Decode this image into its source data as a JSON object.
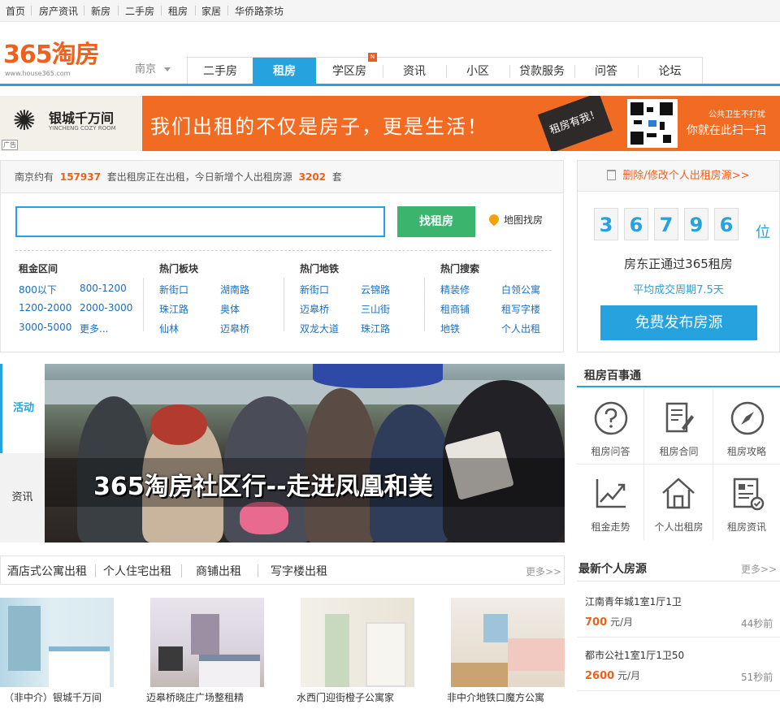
{
  "topbar": {
    "items": [
      "首页",
      "房产资讯",
      "新房",
      "二手房",
      "租房",
      "家居",
      "华侨路茶坊"
    ]
  },
  "logo": {
    "text": "365淘房",
    "url": "www.house365.com"
  },
  "city": "南京",
  "nav": {
    "tabs": [
      "二手房",
      "租房",
      "学区房",
      "资讯",
      "小区",
      "贷款服务",
      "问答",
      "论坛"
    ],
    "active": 1,
    "badge": "N"
  },
  "banner": {
    "ad_label": "广告",
    "brand_name": "银城千万间",
    "brand_sub": "YINCHENG COZY ROOM",
    "slogan": "我们出租的不仅是房子，更是生活！",
    "stamp": "租房有我！",
    "qr_text1": "公共卫生不打扰",
    "qr_text2": "你就在此扫一扫"
  },
  "search": {
    "stat_prefix": "南京约有",
    "stat_total": "157937",
    "stat_mid": "套出租房正在出租，今日新增个人出租房源",
    "stat_new": "3202",
    "stat_suffix": "套",
    "placeholder": "",
    "button": "找租房",
    "map_link": "地图找房",
    "columns": [
      {
        "title": "租金区间",
        "links": [
          "800以下",
          "800-1200",
          "1200-2000",
          "2000-3000",
          "3000-5000",
          "更多..."
        ]
      },
      {
        "title": "热门板块",
        "links": [
          "新街口",
          "湖南路",
          "珠江路",
          "奥体",
          "仙林",
          "迈皋桥"
        ]
      },
      {
        "title": "热门地铁",
        "links": [
          "新街口",
          "云锦路",
          "迈皋桥",
          "三山街",
          "双龙大道",
          "珠江路"
        ]
      },
      {
        "title": "热门搜索",
        "links": [
          "精装修",
          "白领公寓",
          "租商铺",
          "租写字楼",
          "地铁",
          "个人出租"
        ]
      }
    ]
  },
  "publish": {
    "delete_link": "删除/修改个人出租房源>>",
    "digits": [
      "3",
      "6",
      "7",
      "9",
      "6"
    ],
    "unit": "位",
    "line1": "房东正通过365租房",
    "line2": "平均成交周期7.5天",
    "button": "免费发布房源"
  },
  "slider": {
    "tabs": [
      "活动",
      "资讯"
    ],
    "caption": "365淘房社区行--走进凤凰和美"
  },
  "services": {
    "title": "租房百事通",
    "items": [
      {
        "label": "租房问答",
        "icon": "question-icon"
      },
      {
        "label": "租房合同",
        "icon": "contract-icon"
      },
      {
        "label": "租房攻略",
        "icon": "compass-icon"
      },
      {
        "label": "租金走势",
        "icon": "trend-chart-icon"
      },
      {
        "label": "个人出租房",
        "icon": "house-icon"
      },
      {
        "label": "租房资讯",
        "icon": "news-icon"
      }
    ]
  },
  "listing": {
    "tabs": [
      "酒店式公寓出租",
      "个人住宅出租",
      "商铺出租",
      "写字楼出租"
    ],
    "more": "更多>>",
    "cards": [
      {
        "caption": "（非中介）银城千万间"
      },
      {
        "caption": "迈皋桥晓庄广场整租精"
      },
      {
        "caption": "水西门迎街橙子公寓家"
      },
      {
        "caption": "非中介地铁口魔方公寓"
      }
    ]
  },
  "newest": {
    "title": "最新个人房源",
    "more": "更多>>",
    "items": [
      {
        "name": "江南青年城1室1厅1卫",
        "price": "700",
        "unit": "元/月",
        "time": "44秒前"
      },
      {
        "name": "都市公社1室1厅1卫50",
        "price": "2600",
        "unit": "元/月",
        "time": "51秒前"
      }
    ]
  },
  "colors": {
    "accent": "#26a2de",
    "brand": "#f0601d",
    "green": "#3bb46d"
  }
}
